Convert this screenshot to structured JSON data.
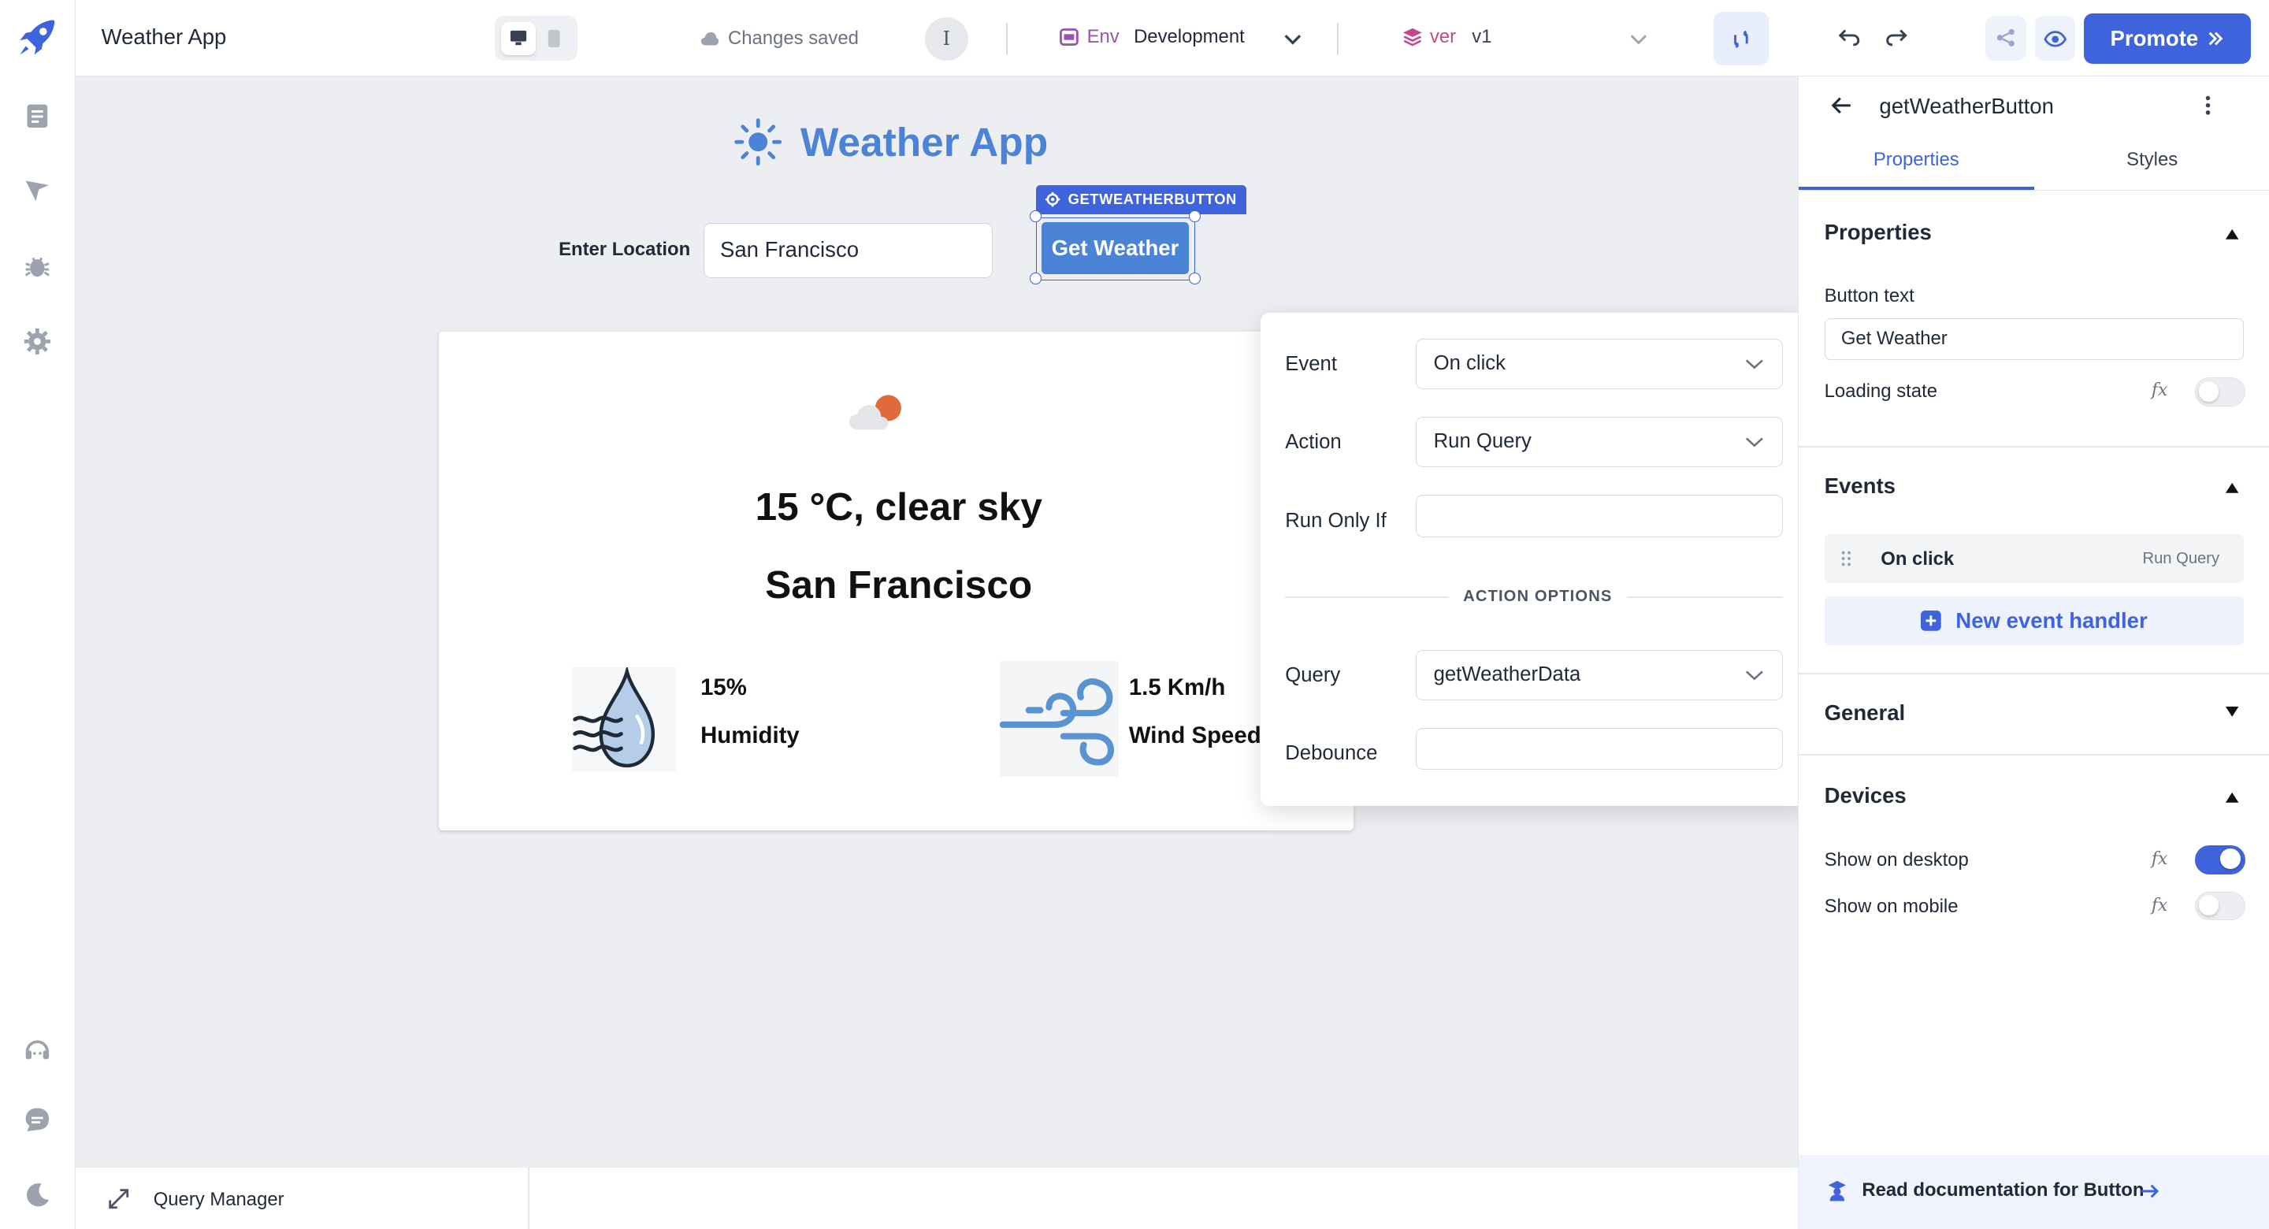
{
  "app": {
    "name": "Weather App"
  },
  "topbar": {
    "save_status": "Changes saved",
    "avatar_initial": "I",
    "env_tag": "Env",
    "env_value": "Development",
    "ver_tag": "ver",
    "ver_value": "v1",
    "promote_label": "Promote"
  },
  "canvas": {
    "title": "Weather App",
    "location_label": "Enter Location",
    "location_value": "San Francisco",
    "component_tag": "GETWEATHERBUTTON",
    "button_label": "Get Weather",
    "weather": {
      "temperature_text": "15 °C, clear sky",
      "city": "San Francisco",
      "humidity_value": "15%",
      "humidity_label": "Humidity",
      "wind_value": "1.5 Km/h",
      "wind_label": "Wind Speed"
    }
  },
  "event_popup": {
    "event_label": "Event",
    "event_value": "On click",
    "action_label": "Action",
    "action_value": "Run Query",
    "run_only_if_label": "Run Only If",
    "run_only_if_value": "",
    "options_header": "ACTION OPTIONS",
    "query_label": "Query",
    "query_value": "getWeatherData",
    "debounce_label": "Debounce",
    "debounce_value": ""
  },
  "panel": {
    "component_name": "getWeatherButton",
    "tabs": [
      "Properties",
      "Styles"
    ],
    "properties": {
      "header": "Properties",
      "button_text_label": "Button text",
      "button_text_value": "Get Weather",
      "loading_state_label": "Loading state",
      "loading_state_on": false
    },
    "events": {
      "header": "Events",
      "items": [
        {
          "event": "On click",
          "action": "Run Query"
        }
      ],
      "new_handler_label": "New event handler"
    },
    "general": {
      "header": "General"
    },
    "devices": {
      "header": "Devices",
      "desktop_label": "Show on desktop",
      "desktop_on": true,
      "mobile_label": "Show on mobile",
      "mobile_on": false
    },
    "fx_label": "fx",
    "doc_link": "Read documentation for Button"
  },
  "bottombar": {
    "query_manager": "Query Manager"
  },
  "colors": {
    "accent": "#3e63dd",
    "title_blue": "#4b83d6",
    "canvas_bg": "#eceef2",
    "env_purple": "#9b51b7",
    "ver_pink": "#c04a8b"
  },
  "icons": [
    "rocket-icon",
    "pages-icon",
    "inspector-icon",
    "debugger-icon",
    "settings-icon",
    "support-icon",
    "chat-icon",
    "moon-icon",
    "desktop-icon",
    "mobile-icon",
    "cloud-icon",
    "chevron-down-icon",
    "sync-icon",
    "undo-icon",
    "redo-icon",
    "share-icon",
    "preview-icon",
    "double-chevron-right-icon",
    "back-arrow-icon",
    "more-vertical-icon",
    "sun-icon",
    "gear-icon",
    "weather-icon",
    "humidity-icon",
    "wind-icon",
    "drag-handle-icon",
    "plus-icon",
    "doc-icon",
    "arrow-right-icon",
    "expand-icon"
  ]
}
